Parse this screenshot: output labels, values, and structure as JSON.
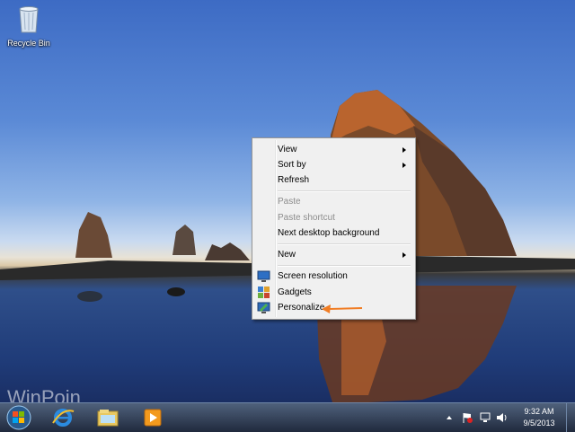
{
  "desktop": {
    "icons": [
      {
        "label": "Recycle Bin",
        "icon": "recycle-bin-icon"
      }
    ],
    "watermark": "WinPoin"
  },
  "context_menu": {
    "items": [
      {
        "label": "View",
        "submenu": true,
        "disabled": false
      },
      {
        "label": "Sort by",
        "submenu": true,
        "disabled": false
      },
      {
        "label": "Refresh",
        "submenu": false,
        "disabled": false
      },
      {
        "label": "Paste",
        "submenu": false,
        "disabled": true
      },
      {
        "label": "Paste shortcut",
        "submenu": false,
        "disabled": true
      },
      {
        "label": "Next desktop background",
        "submenu": false,
        "disabled": false
      },
      {
        "label": "New",
        "submenu": true,
        "disabled": false
      },
      {
        "label": "Screen resolution",
        "icon": "screen-resolution-icon",
        "disabled": false
      },
      {
        "label": "Gadgets",
        "icon": "gadgets-icon",
        "disabled": false
      },
      {
        "label": "Personalize",
        "icon": "personalize-icon",
        "disabled": false,
        "highlighted_by_arrow": true
      }
    ]
  },
  "taskbar": {
    "pinned": [
      "internet-explorer-icon",
      "windows-explorer-icon",
      "media-player-icon"
    ],
    "tray": {
      "time": "9:32 AM",
      "date": "9/5/2013"
    }
  },
  "colors": {
    "annotation_arrow": "#f07d25",
    "menu_bg": "#f0f0f0"
  }
}
